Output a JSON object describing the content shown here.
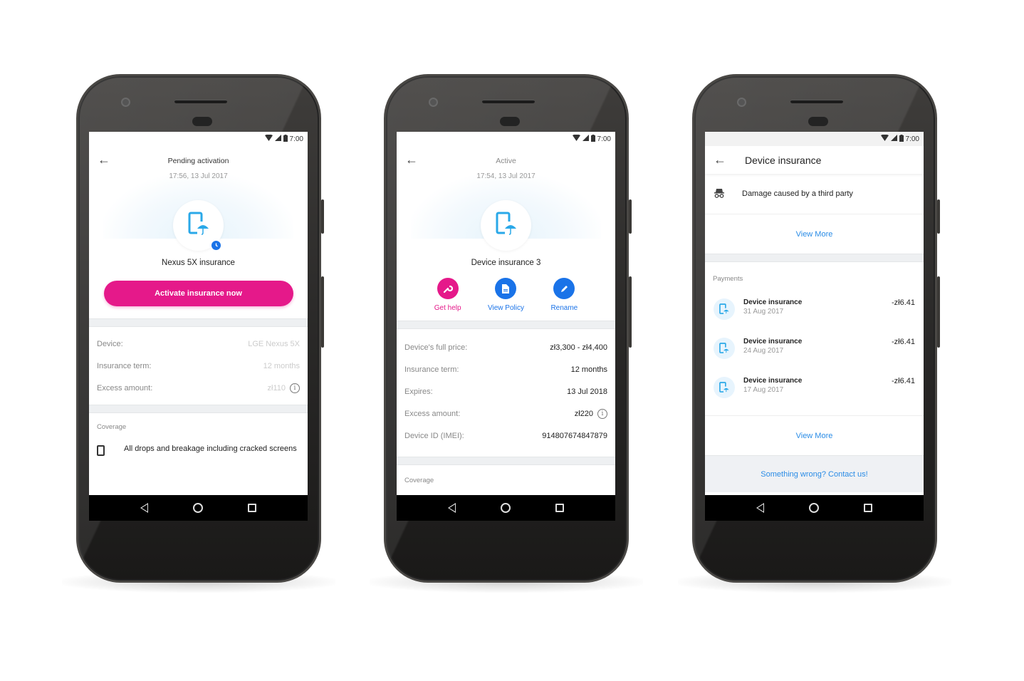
{
  "status_bar": {
    "time": "7:00"
  },
  "colors": {
    "accent_pink": "#e5198a",
    "accent_blue": "#1a73e8",
    "link_blue": "#2a8ce6",
    "icon_blue": "#2aa8e8"
  },
  "screen1": {
    "title": "Pending activation",
    "timestamp": "17:56, 13 Jul 2017",
    "device_name": "Nexus 5X insurance",
    "icon": "phone-umbrella-icon",
    "badge_icon": "clock-icon",
    "primary_button": "Activate insurance now",
    "details": [
      {
        "label": "Device:",
        "value": "LGE Nexus 5X"
      },
      {
        "label": "Insurance term:",
        "value": "12 months"
      },
      {
        "label": "Excess amount:",
        "value": "zł110",
        "info": true
      }
    ],
    "coverage_label": "Coverage",
    "coverage_items": [
      {
        "icon": "cracked-phone-icon",
        "text": "All drops and breakage including cracked screens"
      }
    ]
  },
  "screen2": {
    "title": "Active",
    "timestamp": "17:54, 13 Jul 2017",
    "device_name": "Device insurance 3",
    "icon": "phone-umbrella-icon",
    "actions": [
      {
        "label": "Get help",
        "icon": "wrench-icon",
        "color": "#e5198a"
      },
      {
        "label": "View Policy",
        "icon": "document-icon",
        "color": "#1a73e8"
      },
      {
        "label": "Rename",
        "icon": "pencil-icon",
        "color": "#1a73e8"
      }
    ],
    "details": [
      {
        "label": "Device's full price:",
        "value": "zł3,300 - zł4,400"
      },
      {
        "label": "Insurance term:",
        "value": "12 months"
      },
      {
        "label": "Expires:",
        "value": "13 Jul 2018"
      },
      {
        "label": "Excess amount:",
        "value": "zł220",
        "info": true
      },
      {
        "label": "Device ID (IMEI):",
        "value": "914807674847879"
      }
    ],
    "coverage_label": "Coverage"
  },
  "screen3": {
    "title": "Device insurance",
    "coverage_item": {
      "icon": "incognito-icon",
      "text": "Damage caused by a third party"
    },
    "view_more_1": "View More",
    "payments_label": "Payments",
    "payments": [
      {
        "name": "Device insurance",
        "date": "31 Aug 2017",
        "amount": "-zł6.41"
      },
      {
        "name": "Device insurance",
        "date": "24 Aug 2017",
        "amount": "-zł6.41"
      },
      {
        "name": "Device insurance",
        "date": "17 Aug 2017",
        "amount": "-zł6.41"
      }
    ],
    "view_more_2": "View More",
    "contact": "Something wrong? Contact us!"
  }
}
